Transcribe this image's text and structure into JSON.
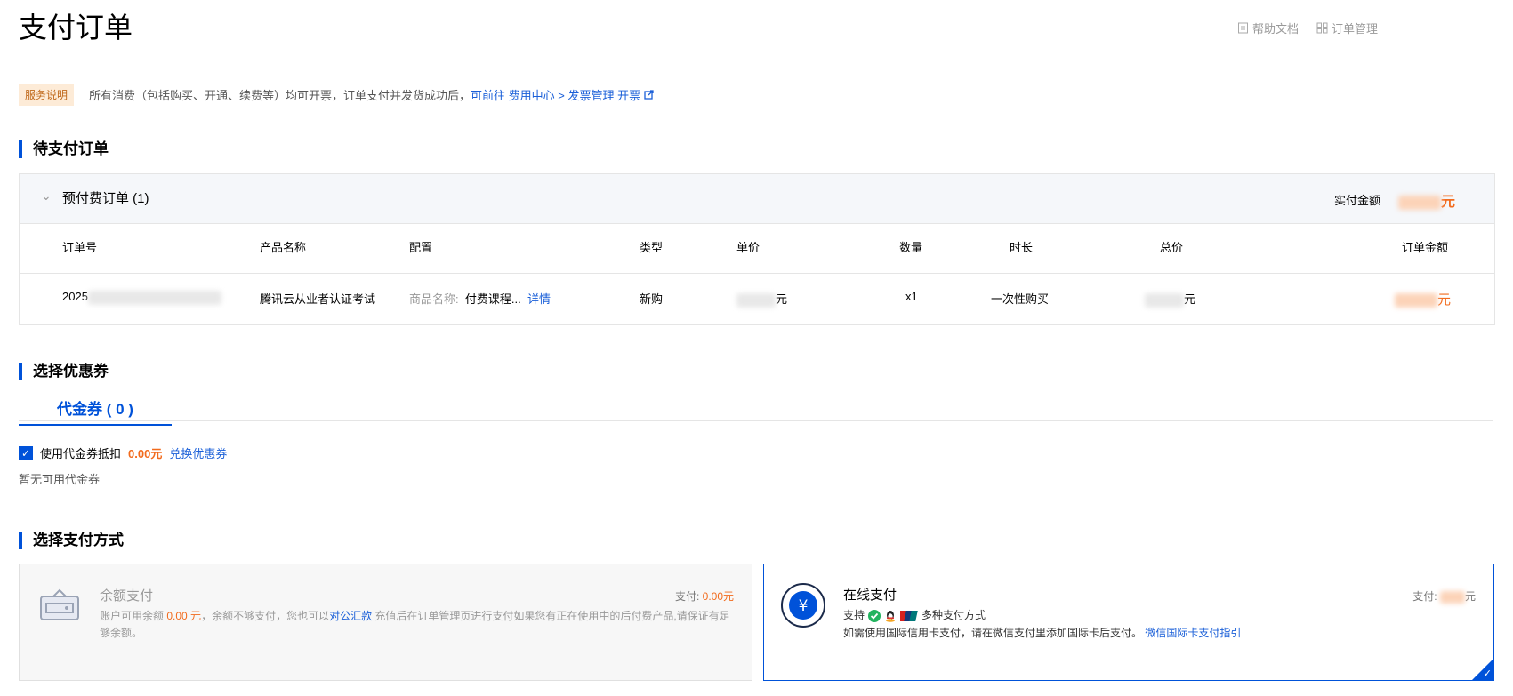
{
  "page": {
    "title": "支付订单"
  },
  "top_links": {
    "help": "帮助文档",
    "orders": "订单管理"
  },
  "notice": {
    "tag": "服务说明",
    "text": "所有消费（包括购买、开通、续费等）均可开票，订单支付并发货成功后，",
    "link": "可前往 费用中心 > 发票管理 开票"
  },
  "pending": {
    "section_title": "待支付订单",
    "group_label": "预付费订单 (1)",
    "paid_label": "实付金额",
    "currency": "元",
    "columns": [
      "订单号",
      "产品名称",
      "配置",
      "类型",
      "单价",
      "数量",
      "时长",
      "总价",
      "订单金额"
    ],
    "row": {
      "order_no_prefix": "2025",
      "product": "腾讯云从业者认证考试",
      "config_label": "商品名称:",
      "config_value": "付费课程...",
      "detail_link": "详情",
      "type": "新购",
      "unit_price_suffix": "元",
      "qty": "x1",
      "duration": "一次性购买",
      "total_suffix": "元",
      "amount_suffix": "元"
    }
  },
  "coupon": {
    "section_title": "选择优惠券",
    "tab_label": "代金券 ( 0 )",
    "checkbox_label": "使用代金券抵扣",
    "deduct_amount": "0.00元",
    "exchange_link": "兑换优惠券",
    "none_text": "暂无可用代金券"
  },
  "payment": {
    "section_title": "选择支付方式",
    "balance": {
      "name": "余额支付",
      "pay_label": "支付:",
      "pay_amount": "0.00元",
      "desc_1": "账户可用余额",
      "balance_amount": "0.00 元",
      "desc_2": "，余额不够支付，您也可以",
      "corp_link": "对公汇款",
      "desc_3": " 充值后在订单管理页进行支付如果您有正在使用中的后付费产品,请保证有足够余额。"
    },
    "online": {
      "name": "在线支付",
      "pay_label": "支付:",
      "pay_suffix": "元",
      "support_label": "支持",
      "support_more": "多种支付方式",
      "intl_text": "如需使用国际信用卡支付，请在微信支付里添加国际卡后支付。",
      "intl_link": "微信国际卡支付指引"
    }
  },
  "colors": {
    "accent": "#0052d9",
    "orange": "#f26b1d"
  }
}
